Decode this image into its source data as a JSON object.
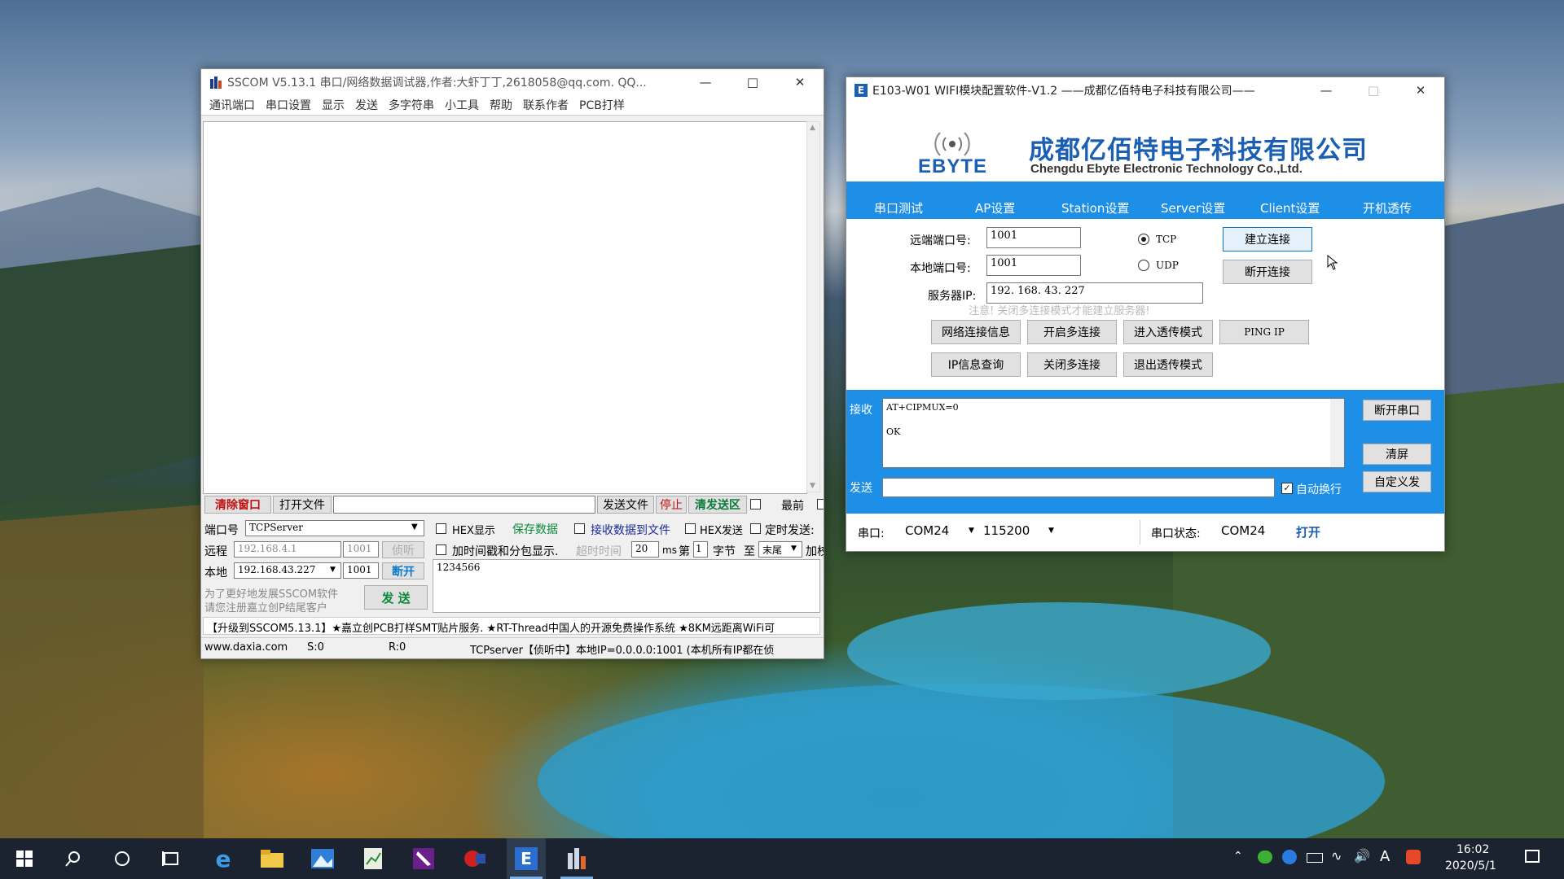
{
  "sscom": {
    "title": "SSCOM V5.13.1 串口/网络数据调试器,作者:大虾丁丁,2618058@qq.com. QQ...",
    "menu": [
      "通讯端口",
      "串口设置",
      "显示",
      "发送",
      "多字符串",
      "小工具",
      "帮助",
      "联系作者",
      "PCB打样"
    ],
    "buttons": {
      "clear_window": "清除窗口",
      "open_file": "打开文件",
      "send_file": "发送文件",
      "stop": "停止",
      "clear_send": "清发送区",
      "save_data": "保存数据",
      "listen": "侦听",
      "disconnect": "断开",
      "send": "发  送"
    },
    "checkboxes": {
      "topmost": "最前",
      "hex_display": "HEX显示",
      "recv_to_file": "接收数据到文件",
      "hex_send": "HEX发送",
      "timed_send": "定时发送:",
      "timestamp": "加时间戳和分包显示.",
      "add": "加校"
    },
    "labels": {
      "port_no": "端口号",
      "remote": "远程",
      "local": "本地",
      "timeout": "超时时间",
      "ms": "ms",
      "nth": "第",
      "byte": "字节",
      "to": "至",
      "promo_line1": "为了更好地发展SSCOM软件",
      "promo_line2": "请您注册嘉立创P结尾客户"
    },
    "fields": {
      "port_type": "TCPServer",
      "remote_ip": "192.168.4.1",
      "remote_port": "1001",
      "local_ip": "192.168.43.227",
      "local_port": "1001",
      "timeout_val": "20",
      "nth_val": "1",
      "end_select": "末尾",
      "send_text": "1234566"
    },
    "ticker": "【升级到SSCOM5.13.1】★嘉立创PCB打样SMT贴片服务. ★RT-Thread中国人的开源免费操作系统 ★8KM远距离WiFi可",
    "status": {
      "website": "www.daxia.com",
      "sent": "S:0",
      "received": "R:0",
      "state": "TCPserver【侦听中】本地IP=0.0.0.0:1001 (本机所有IP都在侦"
    }
  },
  "ebyte": {
    "title": "E103-W01  WIFI模块配置软件-V1.2    ——成都亿佰特电子科技有限公司——",
    "logo_text": "EBYTE",
    "company_cn": "成都亿佰特电子科技有限公司",
    "company_en": "Chengdu Ebyte Electronic Technology Co.,Ltd.",
    "tabs": [
      "串口测试",
      "AP设置",
      "Station设置",
      "Server设置",
      "Client设置",
      "开机透传"
    ],
    "labels": {
      "remote_port": "远端端口号:",
      "local_port": "本地端口号:",
      "server_ip": "服务器IP:",
      "notice": "注意! 关闭多连接模式才能建立服务器!",
      "tcp": "TCP",
      "udp": "UDP",
      "receive": "接收",
      "send": "发送",
      "auto_newline": "自动换行",
      "serial": "串口:",
      "serial_status": "串口状态:"
    },
    "fields": {
      "remote_port": "1001",
      "local_port": "1001",
      "server_ip": "192. 168. 43. 227",
      "receive_line1": "AT+CIPMUX=0",
      "receive_line2": "OK",
      "com": "COM24",
      "baud": "115200",
      "status_com": "COM24",
      "status_open": "打开"
    },
    "buttons": {
      "connect": "建立连接",
      "disconnect": "断开连接",
      "net_info": "网络连接信息",
      "open_multi": "开启多连接",
      "enter_trans": "进入透传模式",
      "ping": "PING IP",
      "ip_query": "IP信息查询",
      "close_multi": "关闭多连接",
      "exit_trans": "退出透传模式",
      "close_serial": "断开串口",
      "clear": "清屏",
      "custom_send": "自定义发"
    },
    "colors": {
      "brand_blue": "#1e8fe6",
      "company_blue": "#1a5fb4"
    }
  },
  "taskbar": {
    "time": "16:02",
    "date": "2020/5/1",
    "ime": "A"
  }
}
